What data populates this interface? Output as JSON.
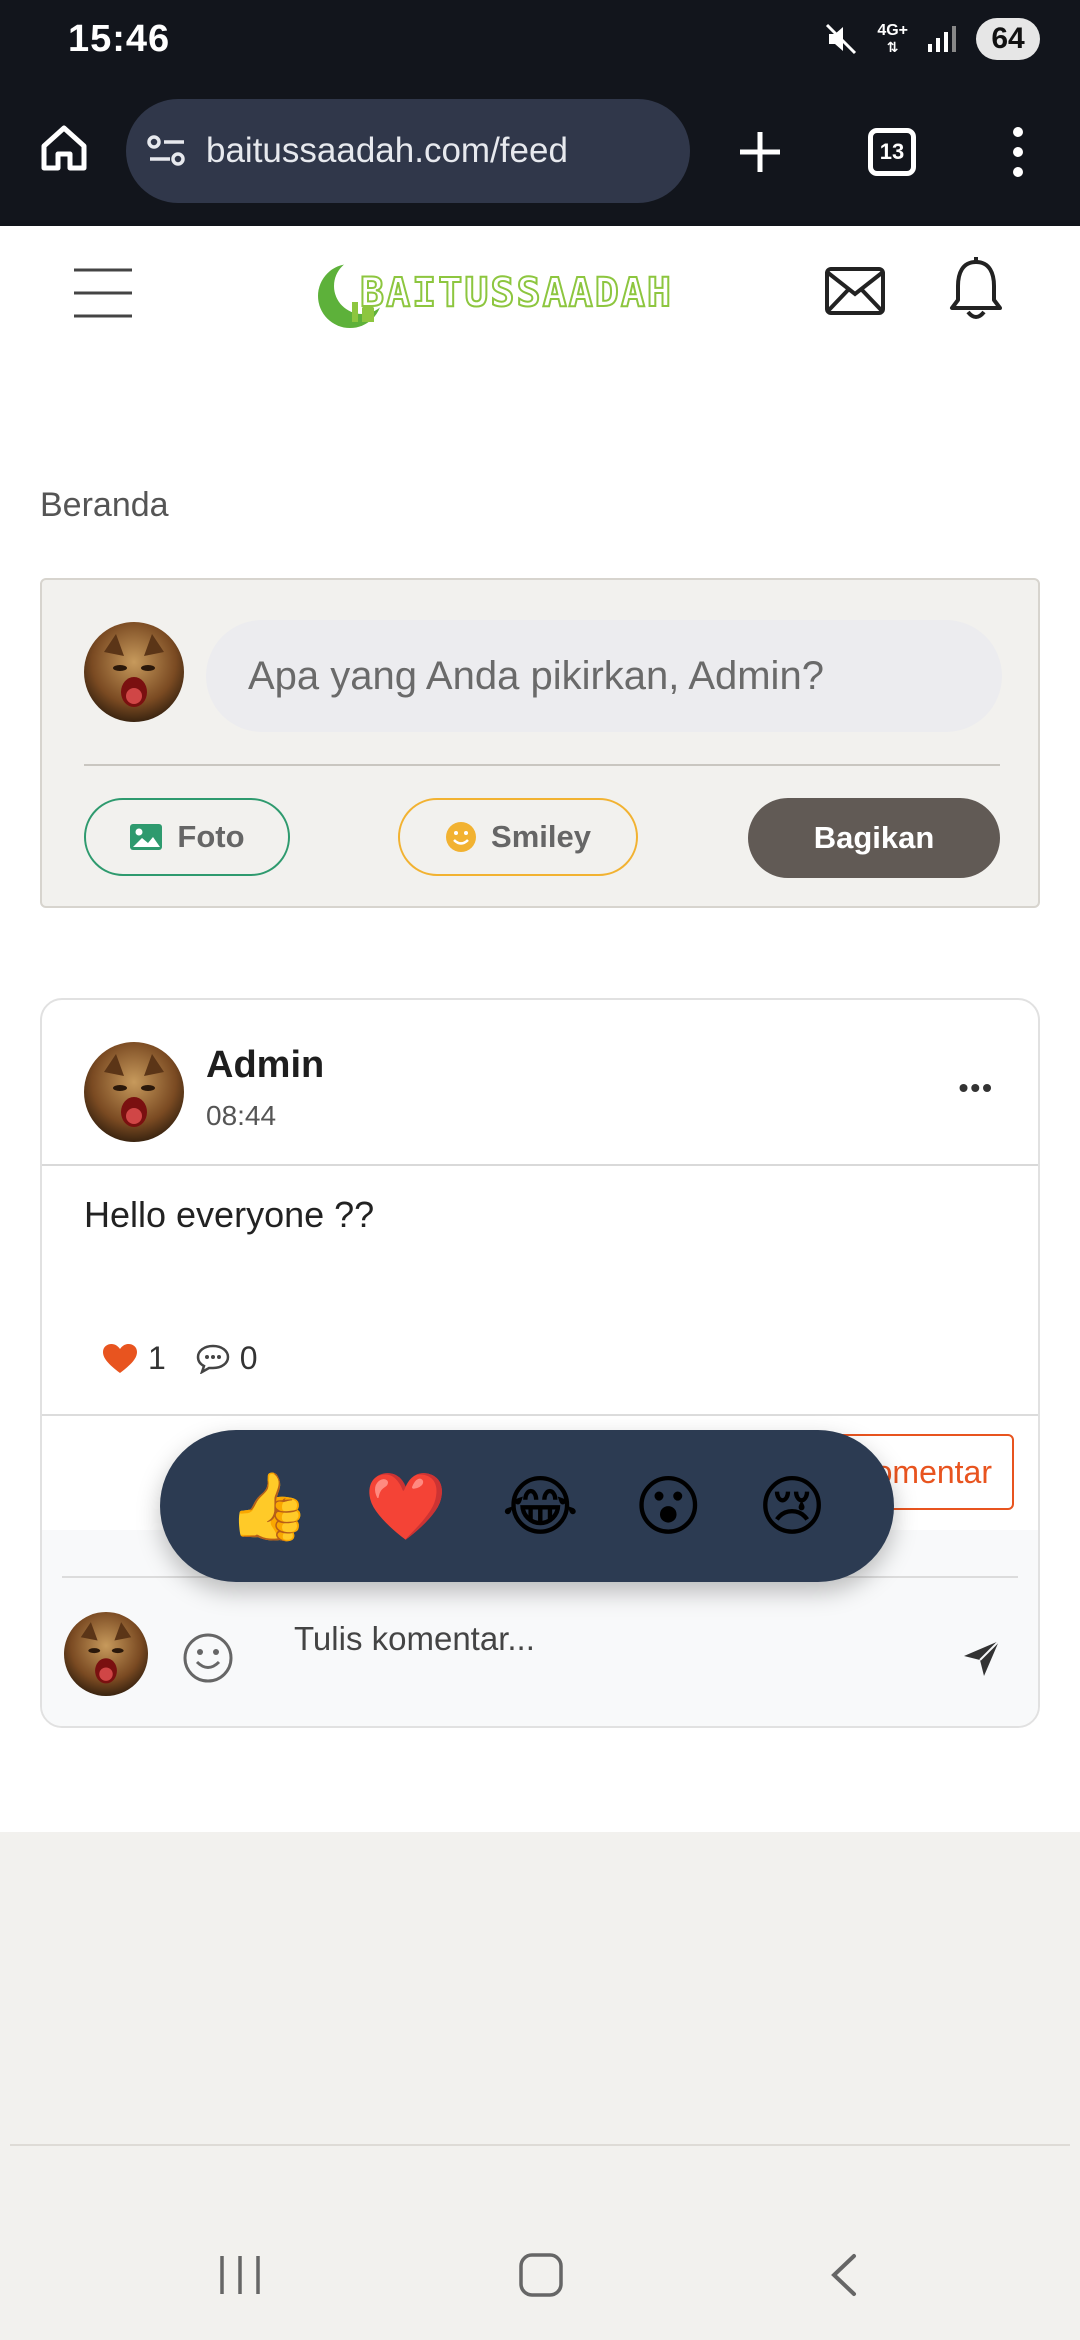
{
  "status_bar": {
    "time": "15:46",
    "network": "4G+",
    "battery": "64"
  },
  "browser": {
    "url": "baitussaadah.com/feed",
    "tab_count": "13"
  },
  "site": {
    "brand": "BAITUSSAADAH"
  },
  "page": {
    "title": "Beranda"
  },
  "composer": {
    "placeholder": "Apa yang Anda pikirkan, Admin?",
    "photo_label": "Foto",
    "smiley_label": "Smiley",
    "share_label": "Bagikan"
  },
  "post": {
    "author": "Admin",
    "time": "08:44",
    "text": "Hello everyone ??",
    "likes": "1",
    "comments": "0",
    "comment_button": "Komentar"
  },
  "reactions": [
    "👍",
    "❤️",
    "😂",
    "😮",
    "😢"
  ],
  "comment_box": {
    "placeholder": "Tulis komentar..."
  },
  "colors": {
    "accent_green": "#2e9a6e",
    "accent_orange": "#e8541f",
    "smiley_yellow": "#f2b231",
    "share_button": "#615a55",
    "reaction_bar": "#2c3b52",
    "browser_bg": "#12151c"
  }
}
